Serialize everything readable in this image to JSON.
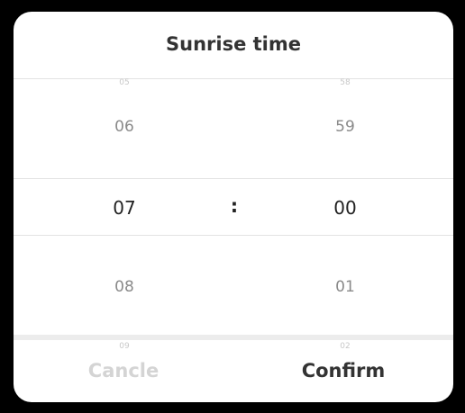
{
  "dialog": {
    "title": "Sunrise time",
    "hours": {
      "above_far": "05",
      "above": "06",
      "selected": "07",
      "below": "08",
      "below_far": "09"
    },
    "separator": ":",
    "minutes": {
      "above_far": "58",
      "above": "59",
      "selected": "00",
      "below": "01",
      "below_far": "02"
    },
    "cancel_label": "Cancle",
    "confirm_label": "Confirm"
  }
}
